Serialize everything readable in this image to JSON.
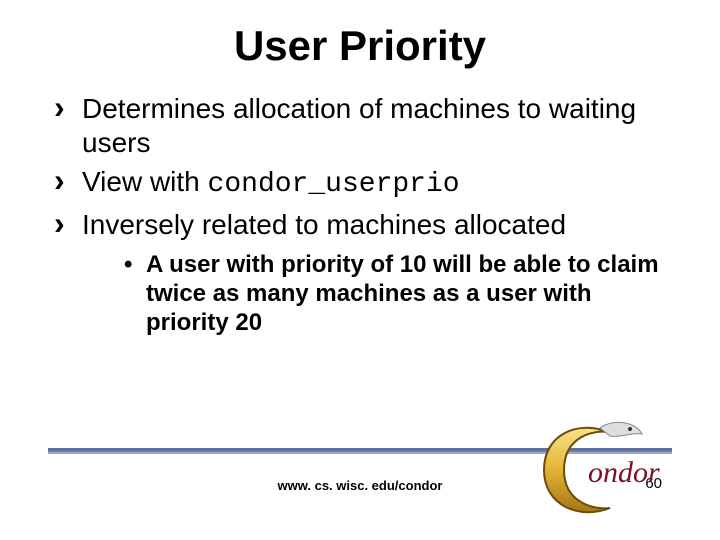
{
  "title": "User Priority",
  "bullets": [
    {
      "text": "Determines allocation of machines to waiting users"
    },
    {
      "prefix": "View with ",
      "code": "condor_userprio"
    },
    {
      "text": "Inversely related to machines allocated"
    }
  ],
  "sub_bullet": "A user with priority of 10 will be able to claim twice as many machines as a user with priority 20",
  "footer_url": "www. cs. wisc. edu/condor",
  "slide_number": "60",
  "logo_text": "ondor",
  "logo_letter": "C"
}
